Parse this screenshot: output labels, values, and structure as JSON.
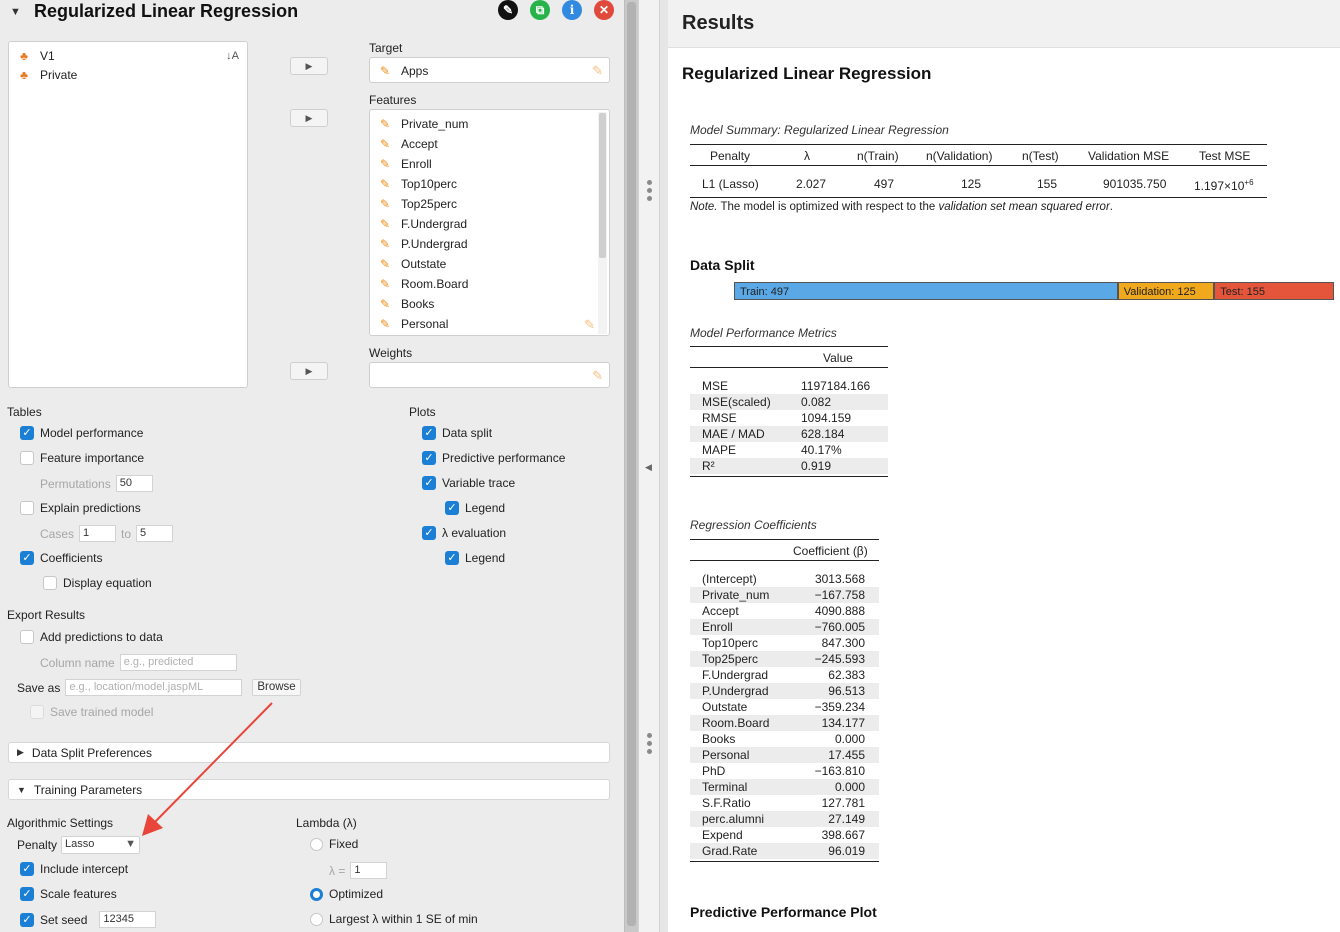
{
  "left": {
    "title": "Regularized Linear Regression",
    "header_buttons": [
      "edit-icon",
      "copy-icon",
      "info-icon",
      "close-icon"
    ],
    "source_vars": [
      {
        "name": "V1",
        "icon": "nominal-icon"
      },
      {
        "name": "Private",
        "icon": "nominal-icon"
      }
    ],
    "target": {
      "label": "Target",
      "value": "Apps"
    },
    "features": {
      "label": "Features",
      "items": [
        "Private_num",
        "Accept",
        "Enroll",
        "Top10perc",
        "Top25perc",
        "F.Undergrad",
        "P.Undergrad",
        "Outstate",
        "Room.Board",
        "Books",
        "Personal"
      ]
    },
    "weights": {
      "label": "Weights"
    },
    "tables": {
      "heading": "Tables",
      "model_performance": "Model performance",
      "feature_importance": "Feature importance",
      "permutations_label": "Permutations",
      "permutations_value": "50",
      "explain_predictions": "Explain predictions",
      "cases_label": "Cases",
      "cases_from": "1",
      "cases_to_label": "to",
      "cases_to": "5",
      "coefficients": "Coefficients",
      "display_equation": "Display equation"
    },
    "plots": {
      "heading": "Plots",
      "data_split": "Data split",
      "predictive_performance": "Predictive performance",
      "variable_trace": "Variable trace",
      "legend1": "Legend",
      "lambda_evaluation": "λ evaluation",
      "legend2": "Legend"
    },
    "export": {
      "heading": "Export Results",
      "add_predictions": "Add predictions to data",
      "column_name_label": "Column name",
      "column_name_placeholder": "e.g., predicted",
      "save_as_label": "Save as",
      "save_as_placeholder": "e.g., location/model.jaspML",
      "browse": "Browse",
      "save_trained": "Save trained model"
    },
    "data_split_prefs": "Data Split Preferences",
    "training_params": "Training Parameters",
    "algorithmic": {
      "heading": "Algorithmic Settings",
      "penalty_label": "Penalty",
      "penalty_value": "Lasso",
      "include_intercept": "Include intercept",
      "scale_features": "Scale features",
      "set_seed": "Set seed",
      "seed_value": "12345"
    },
    "lambda": {
      "heading": "Lambda (λ)",
      "fixed": "Fixed",
      "lambda_eq": "λ =",
      "lambda_value": "1",
      "optimized": "Optimized",
      "largest": "Largest λ within 1 SE of min"
    }
  },
  "right": {
    "results_title": "Results",
    "analysis_title": "Regularized Linear Regression",
    "summary": {
      "caption": "Model Summary: Regularized Linear Regression",
      "headers": [
        "Penalty",
        "λ",
        "n(Train)",
        "n(Validation)",
        "n(Test)",
        "Validation MSE",
        "Test MSE"
      ],
      "row": [
        "L1 (Lasso)",
        "2.027",
        "497",
        "125",
        "155",
        "901035.750"
      ],
      "test_mse_base": "1.197×10",
      "test_mse_exp": "+6",
      "note_prefix": "Note.",
      "note_text": " The model is optimized with respect to the ",
      "note_italic": "validation set mean squared error",
      "note_end": "."
    },
    "data_split": {
      "title": "Data Split",
      "train": "Train: 497",
      "validation": "Validation: 125",
      "test": "Test: 155",
      "train_n": 497,
      "validation_n": 125,
      "test_n": 155,
      "colors": {
        "train": "#5aa8e6",
        "validation": "#f0a81c",
        "test": "#e5553c"
      }
    },
    "metrics": {
      "caption": "Model Performance Metrics",
      "value_header": "Value",
      "rows": [
        {
          "name": "MSE",
          "value": "1197184.166"
        },
        {
          "name": "MSE(scaled)",
          "value": "0.082"
        },
        {
          "name": "RMSE",
          "value": "1094.159"
        },
        {
          "name": "MAE / MAD",
          "value": "628.184"
        },
        {
          "name": "MAPE",
          "value": "40.17%"
        },
        {
          "name": "R²",
          "value": "0.919"
        }
      ]
    },
    "coefficients": {
      "caption": "Regression Coefficients",
      "header": "Coefficient (β)",
      "rows": [
        {
          "name": "(Intercept)",
          "value": "3013.568"
        },
        {
          "name": "Private_num",
          "value": "−167.758"
        },
        {
          "name": "Accept",
          "value": "4090.888"
        },
        {
          "name": "Enroll",
          "value": "−760.005"
        },
        {
          "name": "Top10perc",
          "value": "847.300"
        },
        {
          "name": "Top25perc",
          "value": "−245.593"
        },
        {
          "name": "F.Undergrad",
          "value": "62.383"
        },
        {
          "name": "P.Undergrad",
          "value": "96.513"
        },
        {
          "name": "Outstate",
          "value": "−359.234"
        },
        {
          "name": "Room.Board",
          "value": "134.177"
        },
        {
          "name": "Books",
          "value": "0.000"
        },
        {
          "name": "Personal",
          "value": "17.455"
        },
        {
          "name": "PhD",
          "value": "−163.810"
        },
        {
          "name": "Terminal",
          "value": "0.000"
        },
        {
          "name": "S.F.Ratio",
          "value": "127.781"
        },
        {
          "name": "perc.alumni",
          "value": "27.149"
        },
        {
          "name": "Expend",
          "value": "398.667"
        },
        {
          "name": "Grad.Rate",
          "value": "96.019"
        }
      ]
    },
    "predictive_plot_title": "Predictive Performance Plot"
  }
}
